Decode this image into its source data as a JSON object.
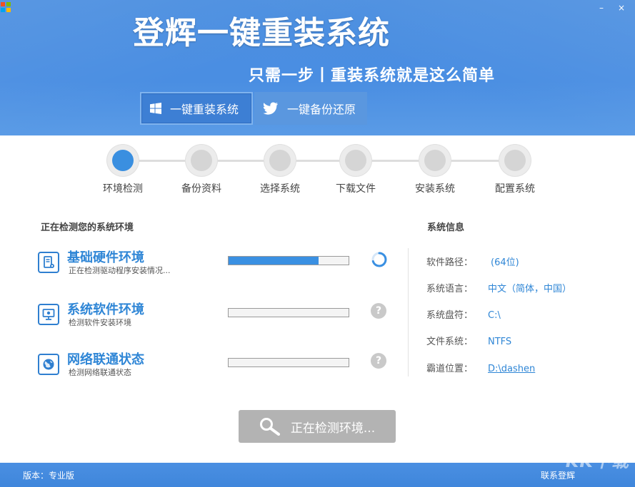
{
  "window": {
    "title": "登辉一键重装系统",
    "slogan": "只需一步丨重装系统就是这么简单",
    "controls": {
      "minimize": "–",
      "close": "×"
    }
  },
  "mode_tabs": [
    {
      "label": "一键重装系统",
      "icon": "windows-icon",
      "active": true
    },
    {
      "label": "一键备份还原",
      "icon": "bird-icon",
      "active": false
    }
  ],
  "steps": [
    {
      "label": "环境检测",
      "active": true
    },
    {
      "label": "备份资料",
      "active": false
    },
    {
      "label": "选择系统",
      "active": false
    },
    {
      "label": "下载文件",
      "active": false
    },
    {
      "label": "安装系统",
      "active": false
    },
    {
      "label": "配置系统",
      "active": false
    }
  ],
  "checks": {
    "section_title": "正在检测您的系统环境",
    "items": [
      {
        "title": "基础硬件环境",
        "subtitle": "正在检测驱动程序安装情况...",
        "progress": 0.75,
        "state": "loading",
        "icon": "hardware-icon"
      },
      {
        "title": "系统软件环境",
        "subtitle": "检测软件安装环境",
        "progress": 0,
        "state": "pending",
        "icon": "software-icon"
      },
      {
        "title": "网络联通状态",
        "subtitle": "检测网络联通状态",
        "progress": 0,
        "state": "pending",
        "icon": "network-icon"
      }
    ],
    "pending_glyph": "?"
  },
  "system_info": {
    "section_title": "系统信息",
    "rows": [
      {
        "key": "软件路径：",
        "value": "(64位)",
        "link": false
      },
      {
        "key": "系统语言：",
        "value": "中文（简体，中国）",
        "link": false
      },
      {
        "key": "系统盘符：",
        "value": "C:\\",
        "link": false
      },
      {
        "key": "文件系统：",
        "value": "NTFS",
        "link": false
      },
      {
        "key": "霸道位置：",
        "value": "D:\\dashen",
        "link": true
      }
    ]
  },
  "main_button": {
    "label": "正在检测环境..."
  },
  "footer": {
    "version": "版本：专业版",
    "contact": "联系登辉",
    "watermark": "KK下载"
  },
  "colors": {
    "header_blue": "#4a8ee2",
    "accent_blue": "#2f86d6",
    "progress_blue": "#3a90e2",
    "disabled_gray": "#b3b3b3"
  }
}
